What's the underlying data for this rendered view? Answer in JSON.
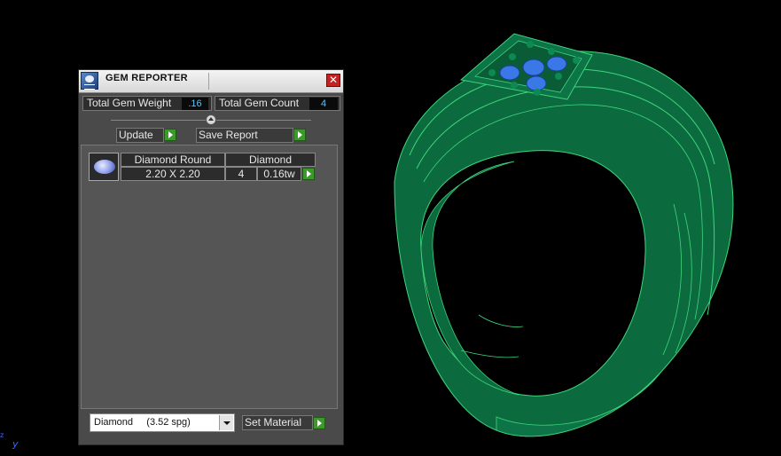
{
  "window": {
    "title": "GEM REPORTER",
    "close_glyph": "✕"
  },
  "stats": {
    "total_weight_label": "Total Gem Weight",
    "total_weight_value": ".16",
    "total_count_label": "Total Gem Count",
    "total_count_value": "4"
  },
  "actions": {
    "update_label": "Update",
    "save_report_label": "Save Report"
  },
  "gems": [
    {
      "shape": "Diamond Round",
      "material": "Diamond",
      "size": "2.20 X 2.20",
      "count": "4",
      "weight": "0.16tw"
    }
  ],
  "material_selector": {
    "selected": "Diamond     (3.52 spg)",
    "button_label": "Set Material"
  },
  "viewport": {
    "axis_label": "y",
    "axis_label_z": "z",
    "model": "ring-with-4-stones",
    "ring_color": "#0b6b3e",
    "wire_color": "#3fd67c",
    "stone_color": "#3a78e8"
  },
  "colors": {
    "accent_green": "#3c9a2a",
    "close_red": "#c42222",
    "value_blue": "#58c4ff"
  }
}
